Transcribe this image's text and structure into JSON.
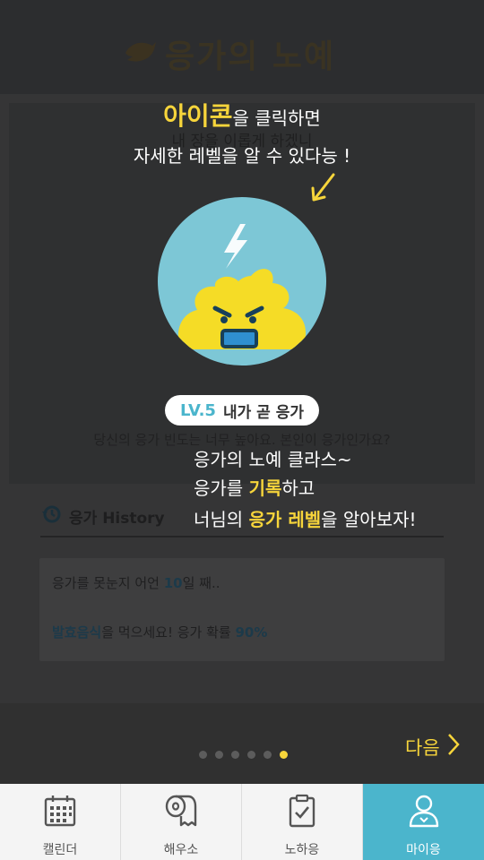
{
  "header": {
    "title": "응가의 노예",
    "logo_icon": "bird-icon"
  },
  "main": {
    "card_title": "내 장을 이롭게 하겠니",
    "question": "당신의 응가 빈도는 너무 높아요. 본인이 응가인가요?",
    "history_label": "응가 History",
    "history_icon": "history-icon",
    "info": {
      "line1_prefix": "응가를 못눈지 어언 ",
      "line1_days": "10",
      "line1_suffix": "일 째..",
      "line2_food": "발효음식",
      "line2_middle": "을 먹으세요! 응가 확률 ",
      "line2_percent": "90%"
    }
  },
  "overlay": {
    "tip_highlight": "아이콘",
    "tip_rest": "을 클릭하면",
    "tip_line2": "자세한 레벨을 알 수 있다능 !",
    "level_code": "LV.5",
    "level_name": "내가 곧 응가",
    "desc1": "응가의 노예 클라스~",
    "desc2_a": "응가를 ",
    "desc2_hl": "기록",
    "desc2_b": "하고",
    "desc3_a": "너님의 ",
    "desc3_hl": "응가 레벨",
    "desc3_b": "을 알아보자!",
    "next_label": "다음",
    "page_count": 6,
    "active_page": 6
  },
  "tabs": [
    {
      "label": "캘린더",
      "icon": "calendar-icon",
      "active": false
    },
    {
      "label": "해우소",
      "icon": "toilet-paper-icon",
      "active": false
    },
    {
      "label": "노하응",
      "icon": "clipboard-check-icon",
      "active": false
    },
    {
      "label": "마이응",
      "icon": "user-icon",
      "active": true
    }
  ],
  "colors": {
    "accent": "#f7d53b",
    "brand_blue": "#4bb5cc",
    "avatar_bg": "#7dc7d6"
  }
}
